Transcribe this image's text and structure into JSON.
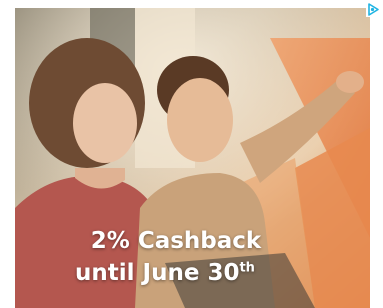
{
  "ad": {
    "headline": "2% Cashback",
    "subline_prefix": "until June 30",
    "subline_suffix": "th"
  },
  "icons": {
    "adchoices": "adchoices-icon"
  },
  "colors": {
    "adchoices": "#1fb4e3",
    "caption": "#ffffff",
    "accent_orange": "#e6834a"
  }
}
